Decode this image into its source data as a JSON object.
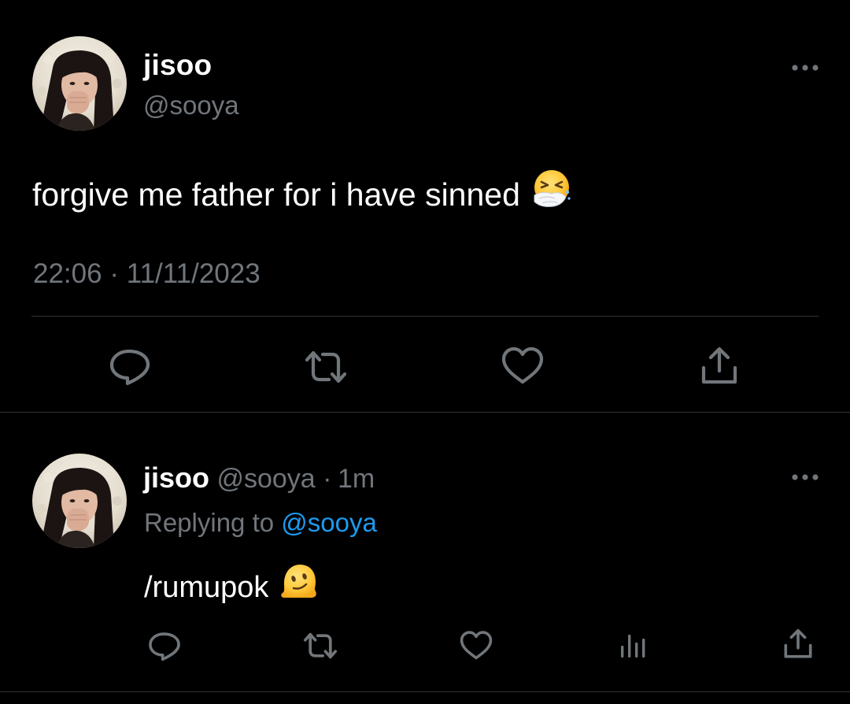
{
  "main_tweet": {
    "display_name": "jisoo",
    "handle": "@sooya",
    "text": "forgive me father for i have sinned",
    "emoji": "sneezing-face-emoji",
    "time": "22:06",
    "separator": "·",
    "date": "11/11/2023",
    "more_icon": "more-dots-icon",
    "actions": [
      {
        "name": "reply",
        "icon": "reply-bubble-icon"
      },
      {
        "name": "retweet",
        "icon": "retweet-icon"
      },
      {
        "name": "like",
        "icon": "heart-icon"
      },
      {
        "name": "share",
        "icon": "share-icon"
      }
    ]
  },
  "reply_tweet": {
    "display_name": "jisoo",
    "handle": "@sooya",
    "separator": "·",
    "time_ago": "1m",
    "replying_prefix": "Replying to",
    "replying_to": "@sooya",
    "text": "/rumupok",
    "emoji": "melting-face-emoji",
    "more_icon": "more-dots-icon",
    "actions": [
      {
        "name": "reply",
        "icon": "reply-bubble-icon"
      },
      {
        "name": "retweet",
        "icon": "retweet-icon"
      },
      {
        "name": "like",
        "icon": "heart-icon"
      },
      {
        "name": "views",
        "icon": "views-bar-chart-icon"
      },
      {
        "name": "share",
        "icon": "share-icon"
      }
    ]
  },
  "colors": {
    "background": "#000000",
    "text": "#ffffff",
    "secondary_text": "#71767b",
    "link": "#1d9bf0",
    "divider": "#2f3336",
    "icon": "#71767b"
  }
}
